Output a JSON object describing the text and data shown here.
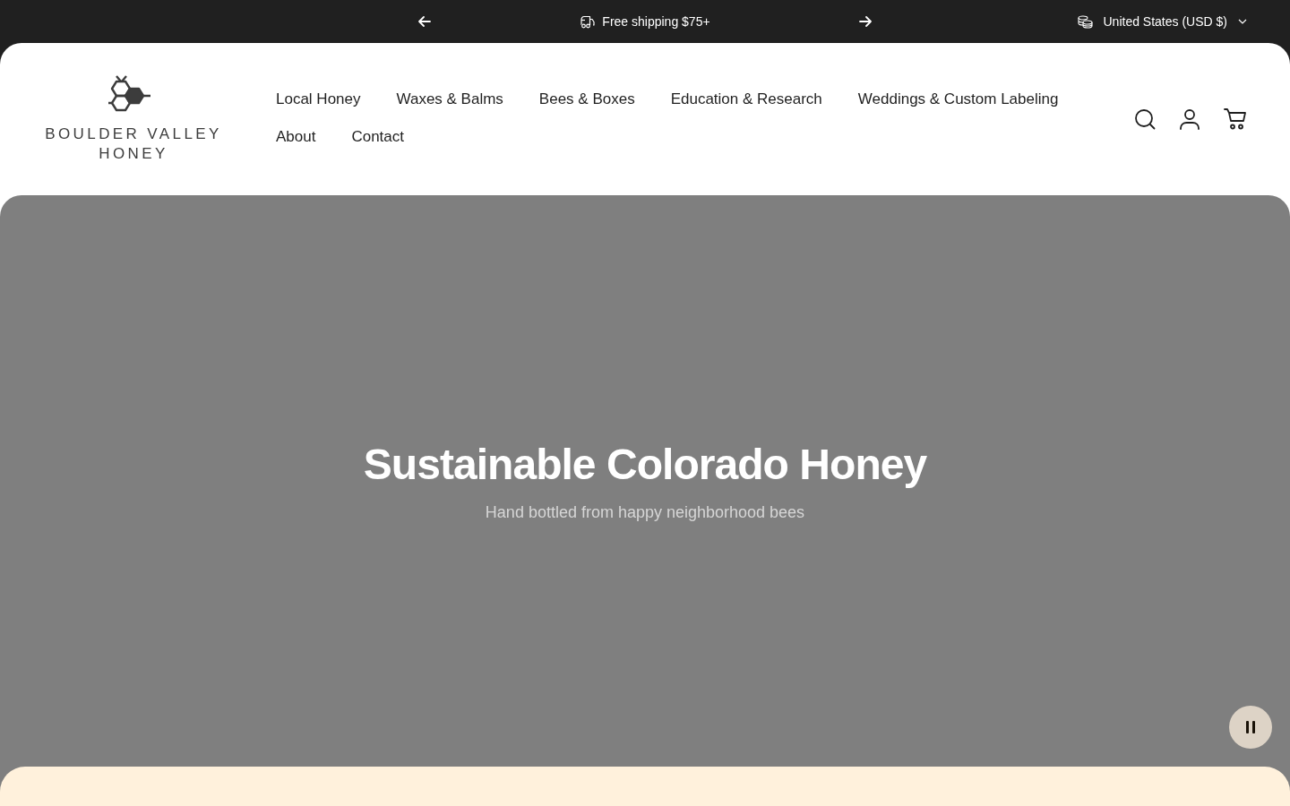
{
  "announcement_bar": {
    "message": "Free shipping $75+",
    "country_selector": "United States (USD $)"
  },
  "header": {
    "logo": {
      "line_1": "BOULDER VALLEY",
      "line_2": "HONEY"
    },
    "nav": [
      {
        "label": "Local Honey"
      },
      {
        "label": "Waxes & Balms"
      },
      {
        "label": "Bees & Boxes"
      },
      {
        "label": "Education & Research"
      },
      {
        "label": "Weddings & Custom Labeling"
      },
      {
        "label": "About"
      },
      {
        "label": "Contact"
      }
    ]
  },
  "hero": {
    "title": "Sustainable Colorado Honey",
    "subtitle": "Hand bottled from happy neighborhood bees"
  }
}
